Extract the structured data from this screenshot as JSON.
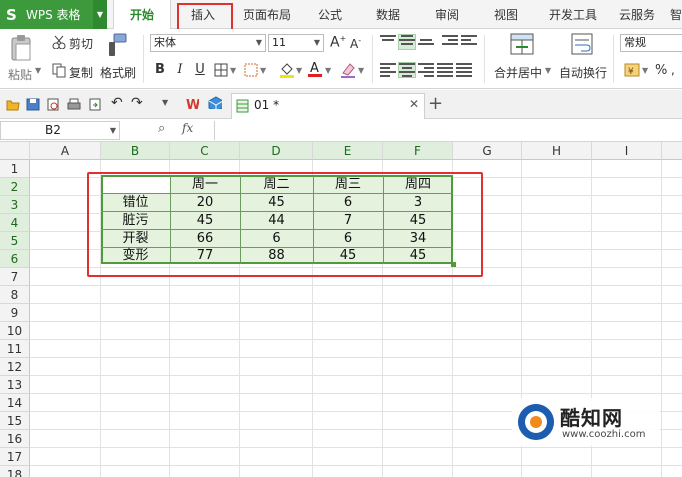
{
  "app": {
    "name": "WPS 表格",
    "logo_letter": "S"
  },
  "menu_tabs": [
    "开始",
    "插入",
    "页面布局",
    "公式",
    "数据",
    "审阅",
    "视图",
    "开发工具",
    "云服务",
    "智"
  ],
  "ribbon": {
    "paste": "粘贴",
    "cut": "剪切",
    "copy": "复制",
    "format_painter": "格式刷",
    "font_name": "宋体",
    "font_size": "11",
    "bold": "B",
    "italic": "I",
    "underline": "U",
    "merge_center": "合并居中",
    "wrap_text": "自动换行",
    "number_format": "常规",
    "percent": "%"
  },
  "document_tab": {
    "title": "01 *"
  },
  "formula_bar": {
    "cell_ref": "B2",
    "fx": "fx",
    "value": ""
  },
  "columns": [
    "A",
    "B",
    "C",
    "D",
    "E",
    "F",
    "G",
    "H",
    "I"
  ],
  "rows": [
    "1",
    "2",
    "3",
    "4",
    "5",
    "6",
    "7",
    "8",
    "9",
    "10",
    "11",
    "12",
    "13",
    "14",
    "15",
    "16",
    "17",
    "18"
  ],
  "table": {
    "header": [
      "",
      "周一",
      "周二",
      "周三",
      "周四"
    ],
    "body": [
      [
        "错位",
        "20",
        "45",
        "6",
        "3"
      ],
      [
        "脏污",
        "45",
        "44",
        "7",
        "45"
      ],
      [
        "开裂",
        "66",
        "6",
        "6",
        "34"
      ],
      [
        "变形",
        "77",
        "88",
        "45",
        "45"
      ]
    ]
  },
  "watermark": {
    "name": "酷知网",
    "url": "www.coozhi.com"
  },
  "colors": {
    "accent": "#3c9a3c",
    "highlight": "#e03131",
    "selection_fill": "#e4f2de",
    "selection_border": "#4f9a3a"
  }
}
